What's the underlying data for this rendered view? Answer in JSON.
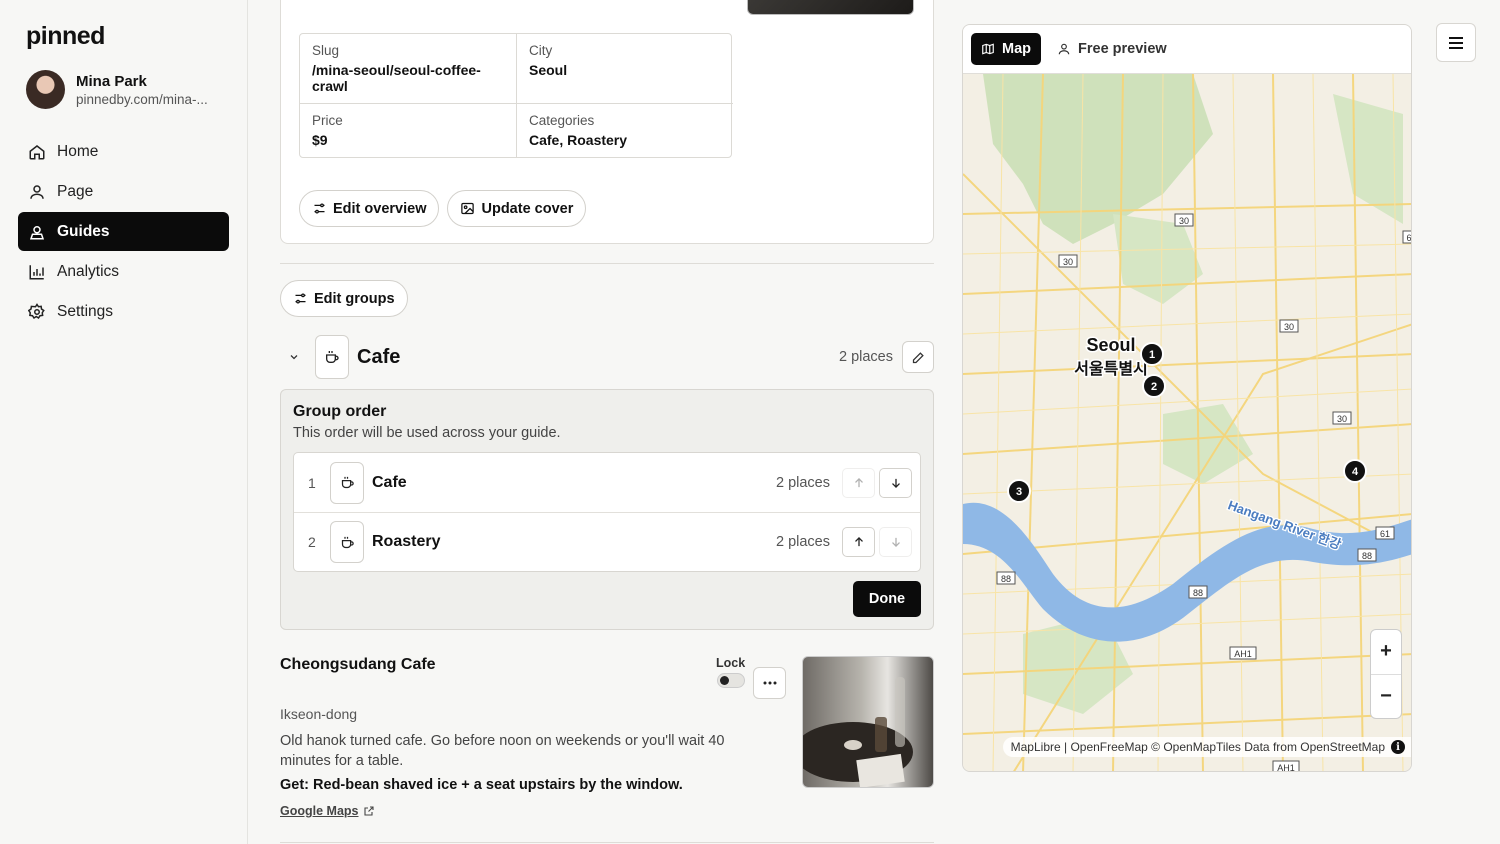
{
  "app": {
    "logo": "pinned"
  },
  "profile": {
    "name": "Mina Park",
    "url": "pinnedby.com/mina-..."
  },
  "nav": [
    {
      "label": "Home",
      "icon": "home-icon",
      "active": false
    },
    {
      "label": "Page",
      "icon": "user-icon",
      "active": false
    },
    {
      "label": "Guides",
      "icon": "guide-icon",
      "active": true
    },
    {
      "label": "Analytics",
      "icon": "bar-chart-icon",
      "active": false
    },
    {
      "label": "Settings",
      "icon": "gear-icon",
      "active": false
    }
  ],
  "overview": {
    "slug_label": "Slug",
    "slug": "/mina-seoul/seoul-coffee-crawl",
    "city_label": "City",
    "city": "Seoul",
    "price_label": "Price",
    "price": "$9",
    "categories_label": "Categories",
    "categories": "Cafe, Roastery",
    "edit_overview": "Edit overview",
    "update_cover": "Update cover"
  },
  "groups": {
    "edit_groups": "Edit groups",
    "current": {
      "title": "Cafe",
      "count": "2 places"
    },
    "order": {
      "title": "Group order",
      "subtitle": "This order will be used across your guide.",
      "items": [
        {
          "num": "1",
          "name": "Cafe",
          "count": "2 places"
        },
        {
          "num": "2",
          "name": "Roastery",
          "count": "2 places"
        }
      ],
      "done": "Done"
    }
  },
  "place": {
    "name": "Cheongsudang Cafe",
    "lock_label": "Lock",
    "area": "Ikseon-dong",
    "description": "Old hanok turned cafe. Go before noon on weekends or you'll wait 40 minutes for a table.",
    "get": "Get: Red-bean shaved ice + a seat upstairs by the window.",
    "link": "Google Maps"
  },
  "map": {
    "tab_map": "Map",
    "tab_preview": "Free preview",
    "city_en": "Seoul",
    "city_ko": "서울특별시",
    "river": "Hangang River 한강",
    "markers": [
      "1",
      "2",
      "3",
      "4"
    ],
    "road_shields": [
      "30",
      "30",
      "30",
      "30",
      "88",
      "88",
      "88",
      "61",
      "6",
      "AH1",
      "AH1"
    ],
    "attribution": "MapLibre | OpenFreeMap © OpenMapTiles Data from OpenStreetMap",
    "zoom_in": "+",
    "zoom_out": "−"
  }
}
